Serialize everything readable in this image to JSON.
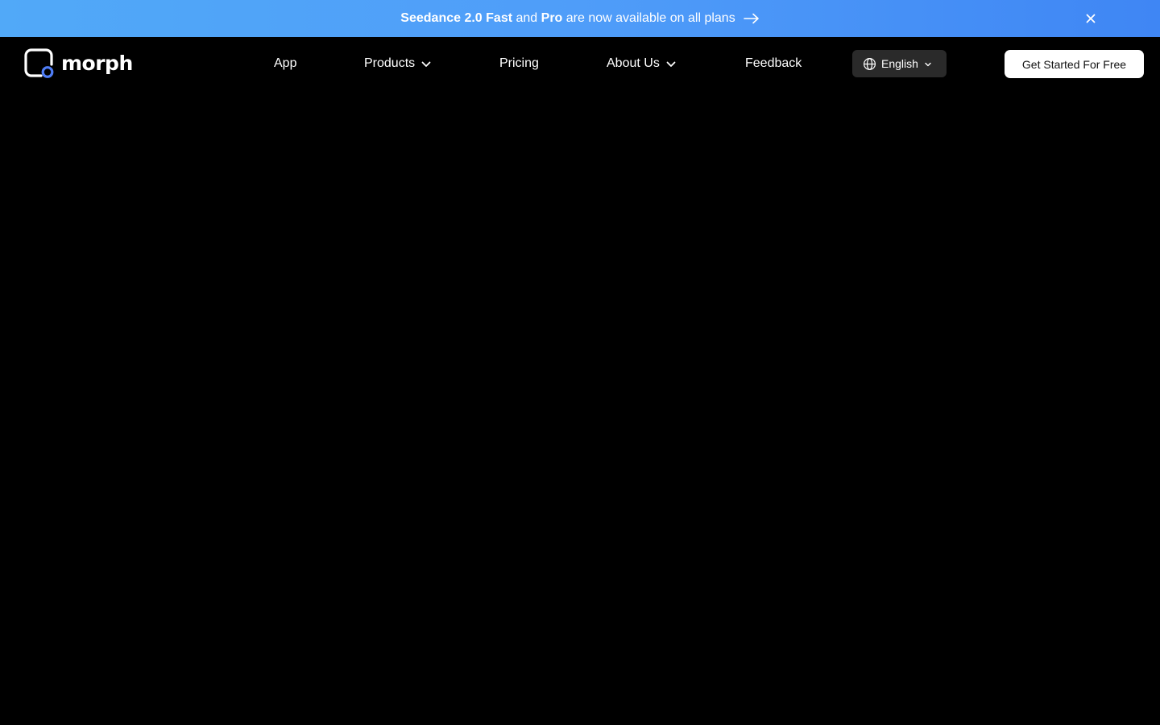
{
  "announcement": {
    "part1_bold": "Seedance 2.0 Fast",
    "part2": "and",
    "part3_bold": "Pro",
    "part4": "are now available on all plans",
    "arrow_icon": "arrow-right-icon",
    "close_icon": "close-icon"
  },
  "header": {
    "logo_text": "morph",
    "nav": {
      "app": "App",
      "products": "Products",
      "pricing": "Pricing",
      "about": "About Us",
      "feedback": "Feedback"
    },
    "language": {
      "selected": "English",
      "icon": "globe-icon"
    },
    "cta_label": "Get Started For Free"
  },
  "colors": {
    "banner_gradient_start": "#51a9f8",
    "banner_gradient_end": "#3f86f4",
    "page_background": "#000000",
    "logo_accent": "#4f7df5"
  }
}
